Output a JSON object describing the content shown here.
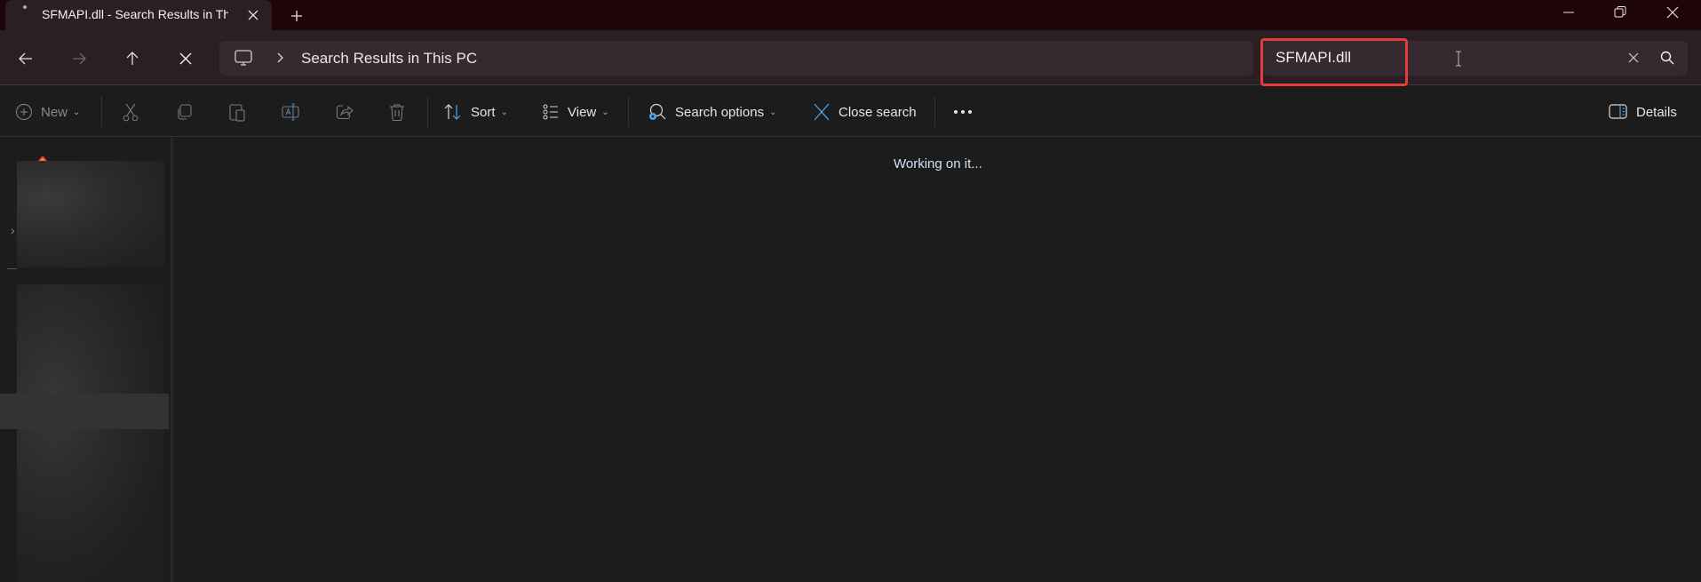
{
  "window": {
    "tab_title": "SFMAPI.dll - Search Results in This PC",
    "tab_close_icon": "close-icon",
    "new_tab_icon": "plus-icon",
    "controls": [
      "minimize-icon",
      "restore-icon",
      "close-icon"
    ]
  },
  "nav": {
    "back_icon": "arrow-left-icon",
    "forward_icon": "arrow-right-icon",
    "up_icon": "arrow-up-icon",
    "stop_icon": "close-icon",
    "address": {
      "location_icon": "this-pc-icon",
      "breadcrumb": "Search Results in This PC"
    },
    "search": {
      "value": "SFMAPI.dll",
      "highlight_color": "#e53b3b"
    }
  },
  "toolbar": {
    "new_label": "New",
    "cut_icon": "scissors-icon",
    "copy_icon": "copy-icon",
    "paste_icon": "paste-icon",
    "rename_icon": "rename-icon",
    "share_icon": "share-icon",
    "delete_icon": "trash-icon",
    "sort_label": "Sort",
    "view_label": "View",
    "search_options_label": "Search options",
    "close_search_label": "Close search",
    "more_icon": "ellipsis-icon",
    "details_label": "Details",
    "accent_color": "#4aa3e8"
  },
  "main": {
    "status": "Working on it..."
  }
}
